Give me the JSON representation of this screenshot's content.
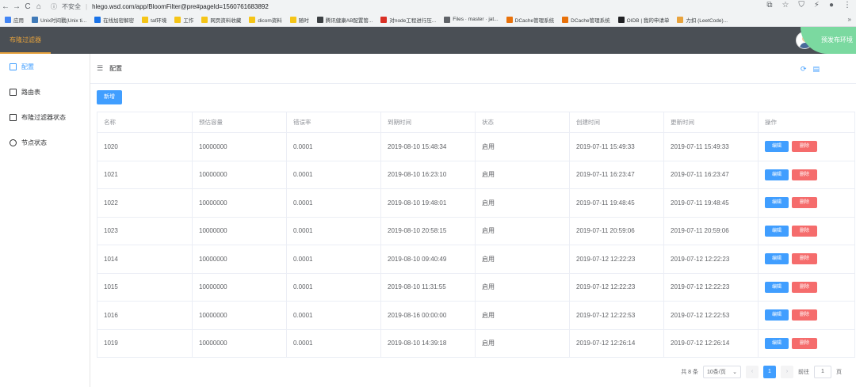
{
  "browser": {
    "security_label": "不安全",
    "url": "hlego.wsd.com/app/BloomFilter@pre#pageId=1560761683892"
  },
  "bookmarks": [
    {
      "label": "应用",
      "color": "#4285f4"
    },
    {
      "label": "Unix时间戳(Unix ti...",
      "color": "#3f7ab8"
    },
    {
      "label": "在线加密解密",
      "color": "#1a73e8"
    },
    {
      "label": "taf环境",
      "color": "#f5c518"
    },
    {
      "label": "工作",
      "color": "#f5c518"
    },
    {
      "label": "网页资料收藏",
      "color": "#f5c518"
    },
    {
      "label": "dicom资料",
      "color": "#f5c518"
    },
    {
      "label": "随时",
      "color": "#f5c518"
    },
    {
      "label": "腾讯健康AB配置管...",
      "color": "#3c4043"
    },
    {
      "label": "对node工程进行压...",
      "color": "#d93025"
    },
    {
      "label": "Files · master · jat...",
      "color": "#5f6368"
    },
    {
      "label": "DCache管理系统",
      "color": "#e8710a"
    },
    {
      "label": "DCache管理系统",
      "color": "#e8710a"
    },
    {
      "label": "OIDB | 我的申请单",
      "color": "#202124"
    },
    {
      "label": "力扣 (LeetCode)...",
      "color": "#e8a33d"
    }
  ],
  "app": {
    "title": "布隆过滤器",
    "env_label": "预发布环境"
  },
  "sidebar": {
    "items": [
      {
        "label": "配置",
        "active": true,
        "icon": "document-icon"
      },
      {
        "label": "路由表",
        "active": false,
        "icon": "document-icon"
      },
      {
        "label": "布隆过滤器状态",
        "active": false,
        "icon": "document-icon"
      },
      {
        "label": "节点状态",
        "active": false,
        "icon": "settings-icon"
      }
    ]
  },
  "main": {
    "title": "配置",
    "add_label": "新增"
  },
  "table": {
    "headers": [
      "名称",
      "预估容量",
      "错误率",
      "到期时间",
      "状态",
      "创建时间",
      "更新时间",
      "操作"
    ],
    "rows": [
      [
        "1020",
        "10000000",
        "0.0001",
        "2019-08-10 15:48:34",
        "启用",
        "2019-07-11 15:49:33",
        "2019-07-11 15:49:33"
      ],
      [
        "1021",
        "10000000",
        "0.0001",
        "2019-08-10 16:23:10",
        "启用",
        "2019-07-11 16:23:47",
        "2019-07-11 16:23:47"
      ],
      [
        "1022",
        "10000000",
        "0.0001",
        "2019-08-10 19:48:01",
        "启用",
        "2019-07-11 19:48:45",
        "2019-07-11 19:48:45"
      ],
      [
        "1023",
        "10000000",
        "0.0001",
        "2019-08-10 20:58:15",
        "启用",
        "2019-07-11 20:59:06",
        "2019-07-11 20:59:06"
      ],
      [
        "1014",
        "10000000",
        "0.0001",
        "2019-08-10 09:40:49",
        "启用",
        "2019-07-12 12:22:23",
        "2019-07-12 12:22:23"
      ],
      [
        "1015",
        "10000000",
        "0.0001",
        "2019-08-10 11:31:55",
        "启用",
        "2019-07-12 12:22:23",
        "2019-07-12 12:22:23"
      ],
      [
        "1016",
        "10000000",
        "0.0001",
        "2019-08-16 00:00:00",
        "启用",
        "2019-07-12 12:22:53",
        "2019-07-12 12:22:53"
      ],
      [
        "1019",
        "10000000",
        "0.0001",
        "2019-08-10 14:39:18",
        "启用",
        "2019-07-12 12:26:14",
        "2019-07-12 12:26:14"
      ]
    ],
    "edit_label": "编辑",
    "delete_label": "删除"
  },
  "pagination": {
    "total_label": "共 8 条",
    "page_size": "10条/页",
    "current_page": "1",
    "goto_label": "前往",
    "goto_value": "1",
    "page_suffix": "页"
  },
  "colors": {
    "primary": "#409eff",
    "danger": "#f56c6c",
    "header_bg": "#4a4f55",
    "accent": "#e6a23c",
    "env_tag": "#7bd9a0"
  }
}
